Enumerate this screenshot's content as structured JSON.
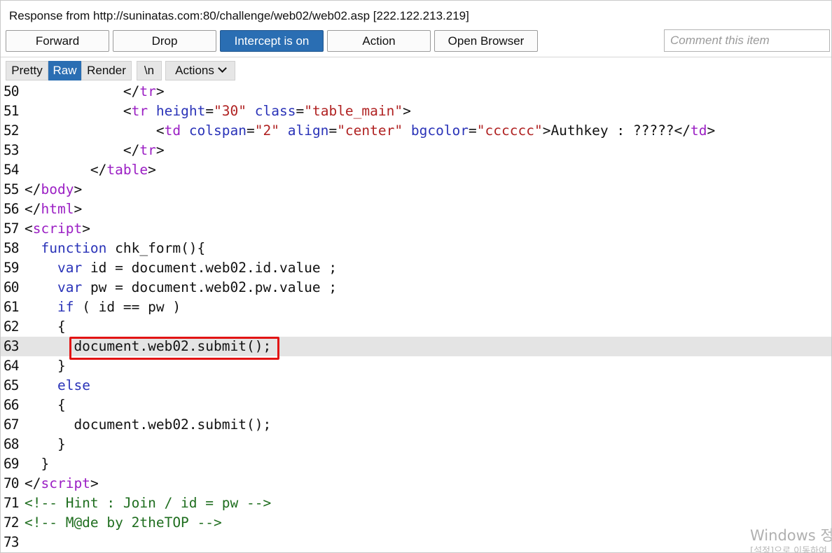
{
  "header": {
    "title": "Response from http://suninatas.com:80/challenge/web02/web02.asp   [222.122.213.219]"
  },
  "toolbar": {
    "forward_label": "Forward",
    "drop_label": "Drop",
    "intercept_label": "Intercept is on",
    "action_label": "Action",
    "open_browser_label": "Open Browser",
    "comment_placeholder": "Comment this item",
    "comment_value": ""
  },
  "view_tabs": {
    "pretty": "Pretty",
    "raw": "Raw",
    "render": "Render",
    "newline": "\\n",
    "actions": "Actions",
    "active": "Raw"
  },
  "colors": {
    "accent": "#2a6eb3",
    "tag": "#9b1fc4",
    "attribute": "#2a33b8",
    "string": "#b02222",
    "comment": "#1f6e1f",
    "highlight_box": "#e21414",
    "current_line": "#e4e4e4"
  },
  "editor": {
    "current_line": "63",
    "highlighted_text": "document.web02.submit();",
    "lines": [
      {
        "no": "50",
        "tokens": [
          {
            "t": "            ",
            "c": "text"
          },
          {
            "t": "</",
            "c": "punct"
          },
          {
            "t": "tr",
            "c": "tag"
          },
          {
            "t": ">",
            "c": "punct"
          }
        ]
      },
      {
        "no": "51",
        "tokens": [
          {
            "t": "            ",
            "c": "text"
          },
          {
            "t": "<",
            "c": "punct"
          },
          {
            "t": "tr",
            "c": "tag"
          },
          {
            "t": " height",
            "c": "attr"
          },
          {
            "t": "=",
            "c": "punct"
          },
          {
            "t": "\"30\"",
            "c": "str"
          },
          {
            "t": " class",
            "c": "attr"
          },
          {
            "t": "=",
            "c": "punct"
          },
          {
            "t": "\"table_main\"",
            "c": "str"
          },
          {
            "t": ">",
            "c": "punct"
          }
        ]
      },
      {
        "no": "52",
        "tokens": [
          {
            "t": "                ",
            "c": "text"
          },
          {
            "t": "<",
            "c": "punct"
          },
          {
            "t": "td",
            "c": "tag"
          },
          {
            "t": " colspan",
            "c": "attr"
          },
          {
            "t": "=",
            "c": "punct"
          },
          {
            "t": "\"2\"",
            "c": "str"
          },
          {
            "t": " align",
            "c": "attr"
          },
          {
            "t": "=",
            "c": "punct"
          },
          {
            "t": "\"center\"",
            "c": "str"
          },
          {
            "t": " bgcolor",
            "c": "attr"
          },
          {
            "t": "=",
            "c": "punct"
          },
          {
            "t": "\"cccccc\"",
            "c": "str"
          },
          {
            "t": ">Authkey : ?????",
            "c": "text"
          },
          {
            "t": "</",
            "c": "punct"
          },
          {
            "t": "td",
            "c": "tag"
          },
          {
            "t": ">",
            "c": "punct"
          }
        ]
      },
      {
        "no": "53",
        "tokens": [
          {
            "t": "            ",
            "c": "text"
          },
          {
            "t": "</",
            "c": "punct"
          },
          {
            "t": "tr",
            "c": "tag"
          },
          {
            "t": ">",
            "c": "punct"
          }
        ]
      },
      {
        "no": "54",
        "tokens": [
          {
            "t": "        ",
            "c": "text"
          },
          {
            "t": "</",
            "c": "punct"
          },
          {
            "t": "table",
            "c": "tag"
          },
          {
            "t": ">",
            "c": "punct"
          }
        ]
      },
      {
        "no": "55",
        "tokens": [
          {
            "t": "</",
            "c": "punct"
          },
          {
            "t": "body",
            "c": "tag"
          },
          {
            "t": ">",
            "c": "punct"
          }
        ]
      },
      {
        "no": "56",
        "tokens": [
          {
            "t": "</",
            "c": "punct"
          },
          {
            "t": "html",
            "c": "tag"
          },
          {
            "t": ">",
            "c": "punct"
          }
        ]
      },
      {
        "no": "57",
        "tokens": [
          {
            "t": "<",
            "c": "punct"
          },
          {
            "t": "script",
            "c": "tag"
          },
          {
            "t": ">",
            "c": "punct"
          }
        ]
      },
      {
        "no": "58",
        "tokens": [
          {
            "t": "  ",
            "c": "text"
          },
          {
            "t": "function",
            "c": "kw"
          },
          {
            "t": " chk_form(){",
            "c": "text"
          }
        ]
      },
      {
        "no": "59",
        "tokens": [
          {
            "t": "    ",
            "c": "text"
          },
          {
            "t": "var",
            "c": "kw"
          },
          {
            "t": " id = document.web02.id.value ;",
            "c": "text"
          }
        ]
      },
      {
        "no": "60",
        "tokens": [
          {
            "t": "    ",
            "c": "text"
          },
          {
            "t": "var",
            "c": "kw"
          },
          {
            "t": " pw = document.web02.pw.value ;",
            "c": "text"
          }
        ]
      },
      {
        "no": "61",
        "tokens": [
          {
            "t": "    ",
            "c": "text"
          },
          {
            "t": "if",
            "c": "kw"
          },
          {
            "t": " ( id == pw )",
            "c": "text"
          }
        ]
      },
      {
        "no": "62",
        "tokens": [
          {
            "t": "    {",
            "c": "text"
          }
        ]
      },
      {
        "no": "63",
        "tokens": [
          {
            "t": "      document.web02.submit();",
            "c": "text"
          }
        ]
      },
      {
        "no": "64",
        "tokens": [
          {
            "t": "    }",
            "c": "text"
          }
        ]
      },
      {
        "no": "65",
        "tokens": [
          {
            "t": "    ",
            "c": "text"
          },
          {
            "t": "else",
            "c": "kw"
          }
        ]
      },
      {
        "no": "66",
        "tokens": [
          {
            "t": "    {",
            "c": "text"
          }
        ]
      },
      {
        "no": "67",
        "tokens": [
          {
            "t": "      document.web02.submit();",
            "c": "text"
          }
        ]
      },
      {
        "no": "68",
        "tokens": [
          {
            "t": "    }",
            "c": "text"
          }
        ]
      },
      {
        "no": "69",
        "tokens": [
          {
            "t": "  }",
            "c": "text"
          }
        ]
      },
      {
        "no": "70",
        "tokens": [
          {
            "t": "</",
            "c": "punct"
          },
          {
            "t": "script",
            "c": "tag"
          },
          {
            "t": ">",
            "c": "punct"
          }
        ]
      },
      {
        "no": "71",
        "tokens": [
          {
            "t": "<!-- Hint : Join / id = pw -->",
            "c": "comment"
          }
        ]
      },
      {
        "no": "72",
        "tokens": [
          {
            "t": "<!-- M@de by 2theTOP -->",
            "c": "comment"
          }
        ]
      },
      {
        "no": "73",
        "tokens": []
      }
    ]
  },
  "watermark": {
    "main": "Windows 정품 인증",
    "sub": "[설정]으로 이동하여"
  }
}
